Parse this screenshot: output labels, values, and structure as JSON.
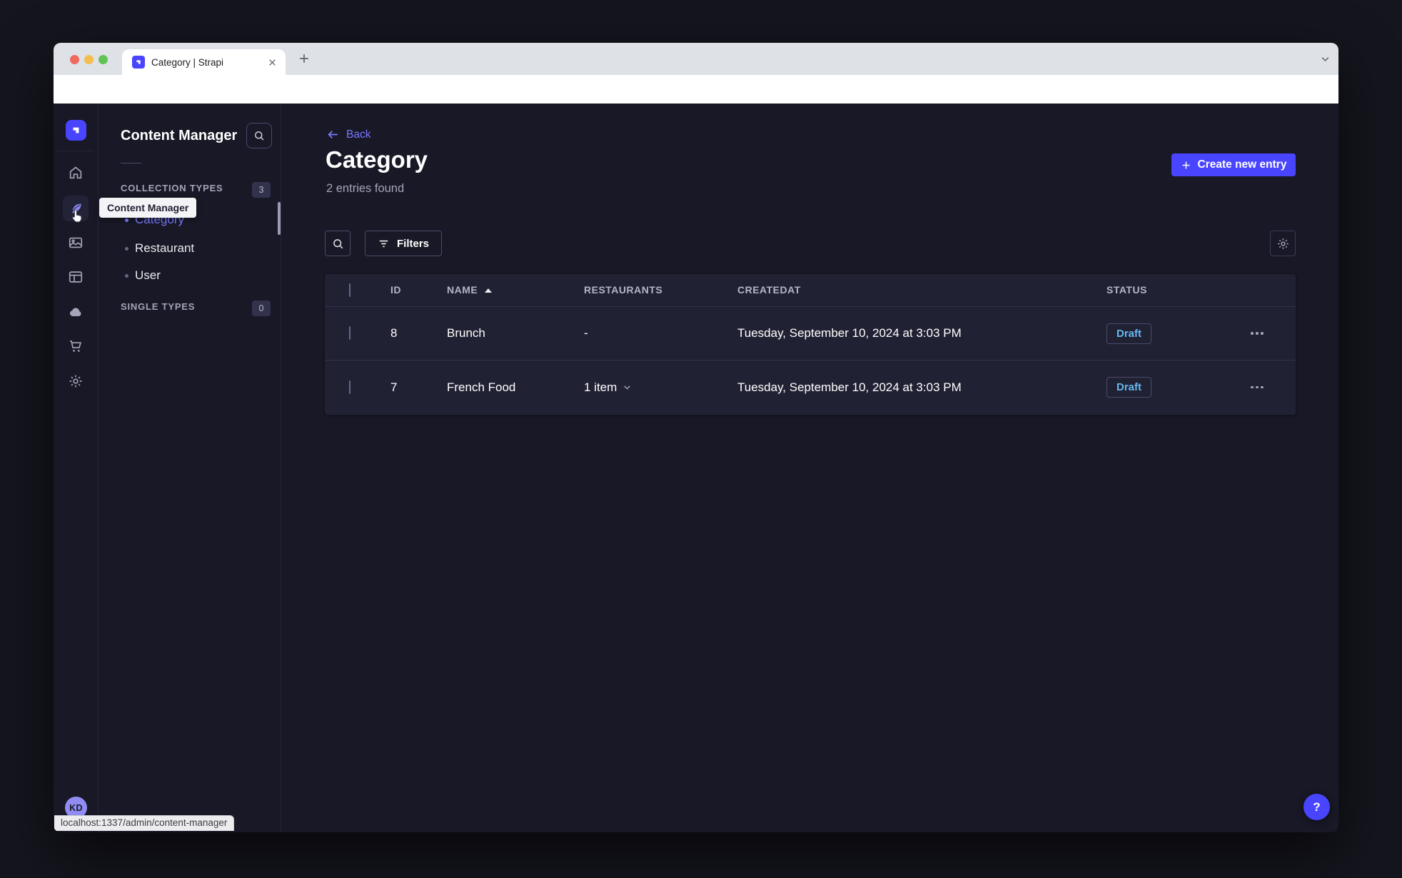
{
  "colors": {
    "primary": "#4945ff",
    "primary_light": "#7b79ff",
    "draft_text": "#66b7f1",
    "app_bg": "#181826",
    "card_bg": "#212134"
  },
  "browser": {
    "tab_title": "Category | Strapi",
    "url": "localhost:1337/admin/content-manager/collection-types/api::category.category?page=1&pageSize=10&sort=Name%3AASC",
    "status_bar": "localhost:1337/admin/content-manager"
  },
  "rail": {
    "tooltip": "Content Manager",
    "avatar_initials": "KD",
    "icons": [
      "strapi-logo",
      "home",
      "content-manager-feather",
      "media-library",
      "content-type-builder",
      "cloud",
      "marketplace-cart",
      "settings-gear"
    ]
  },
  "subnav": {
    "title": "Content Manager",
    "sections": [
      {
        "label": "COLLECTION TYPES",
        "count": "3",
        "items": [
          {
            "label": "Category",
            "active": true
          },
          {
            "label": "Restaurant",
            "active": false
          },
          {
            "label": "User",
            "active": false
          }
        ]
      },
      {
        "label": "SINGLE TYPES",
        "count": "0",
        "items": []
      }
    ]
  },
  "main": {
    "back_label": "Back",
    "title": "Category",
    "subtitle": "2 entries found",
    "create_button": "Create new entry",
    "filters_button": "Filters"
  },
  "table": {
    "headers": {
      "id": "ID",
      "name": "NAME",
      "restaurants": "RESTAURANTS",
      "createdat": "CREATEDAT",
      "status": "STATUS"
    },
    "sort": {
      "column": "NAME",
      "direction": "asc"
    },
    "rows": [
      {
        "id": "8",
        "name": "Brunch",
        "restaurants": "-",
        "createdat": "Tuesday, September 10, 2024 at 3:03 PM",
        "status": "Draft"
      },
      {
        "id": "7",
        "name": "French Food",
        "restaurants": "1 item",
        "createdat": "Tuesday, September 10, 2024 at 3:03 PM",
        "status": "Draft"
      }
    ]
  },
  "help_label": "?"
}
